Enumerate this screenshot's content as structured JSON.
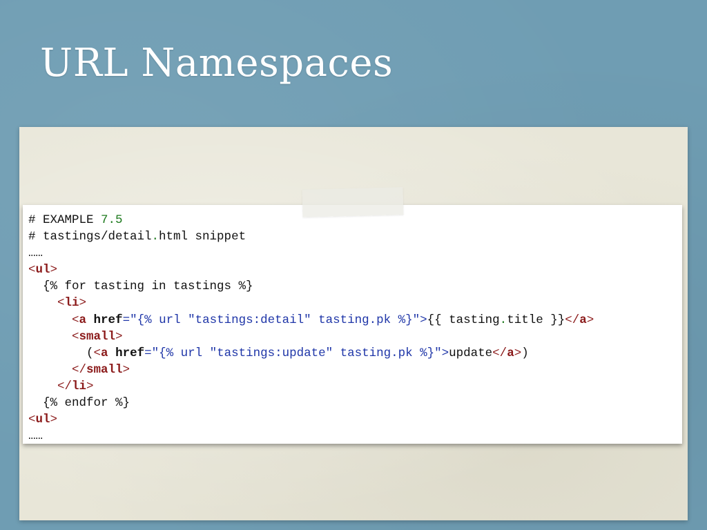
{
  "slide": {
    "title": "URL Namespaces"
  },
  "code": {
    "lines": [
      [
        {
          "t": "# EXAMPLE ",
          "c": ""
        },
        {
          "t": "7.5",
          "c": "num"
        }
      ],
      [
        {
          "t": "# tastings/detail",
          "c": ""
        },
        {
          "t": ".",
          "c": "punct"
        },
        {
          "t": "html snippet",
          "c": ""
        }
      ],
      [
        {
          "t": "……",
          "c": ""
        }
      ],
      [
        {
          "t": "<",
          "c": "tag"
        },
        {
          "t": "ul",
          "c": "tagname"
        },
        {
          "t": ">",
          "c": "tag"
        }
      ],
      [
        {
          "t": "  {% for tasting in tastings %}",
          "c": ""
        }
      ],
      [
        {
          "t": "    <",
          "c": "tag"
        },
        {
          "t": "li",
          "c": "tagname"
        },
        {
          "t": ">",
          "c": "tag"
        }
      ],
      [
        {
          "t": "      <",
          "c": "tag"
        },
        {
          "t": "a",
          "c": "tagname"
        },
        {
          "t": " ",
          "c": ""
        },
        {
          "t": "href",
          "c": "attr"
        },
        {
          "t": "=\"{% url \"tastings:detail\" tasting.pk %}\">",
          "c": "str"
        },
        {
          "t": "{{ tasting",
          "c": ""
        },
        {
          "t": ".",
          "c": "punct"
        },
        {
          "t": "title }}",
          "c": ""
        },
        {
          "t": "</",
          "c": "tag"
        },
        {
          "t": "a",
          "c": "tagname"
        },
        {
          "t": ">",
          "c": "tag"
        }
      ],
      [
        {
          "t": "      <",
          "c": "tag"
        },
        {
          "t": "small",
          "c": "tagname"
        },
        {
          "t": ">",
          "c": "tag"
        }
      ],
      [
        {
          "t": "        (",
          "c": ""
        },
        {
          "t": "<",
          "c": "tag"
        },
        {
          "t": "a",
          "c": "tagname"
        },
        {
          "t": " ",
          "c": ""
        },
        {
          "t": "href",
          "c": "attr"
        },
        {
          "t": "=\"{% url \"tastings:update\" tasting.pk %}\">",
          "c": "str"
        },
        {
          "t": "update",
          "c": ""
        },
        {
          "t": "</",
          "c": "tag"
        },
        {
          "t": "a",
          "c": "tagname"
        },
        {
          "t": ">",
          "c": "tag"
        },
        {
          "t": ")",
          "c": ""
        }
      ],
      [
        {
          "t": "      </",
          "c": "tag"
        },
        {
          "t": "small",
          "c": "tagname"
        },
        {
          "t": ">",
          "c": "tag"
        }
      ],
      [
        {
          "t": "    </",
          "c": "tag"
        },
        {
          "t": "li",
          "c": "tagname"
        },
        {
          "t": ">",
          "c": "tag"
        }
      ],
      [
        {
          "t": "  {% endfor %}",
          "c": ""
        }
      ],
      [
        {
          "t": "<",
          "c": "tag"
        },
        {
          "t": "ul",
          "c": "tagname"
        },
        {
          "t": ">",
          "c": "tag"
        }
      ],
      [
        {
          "t": "……",
          "c": ""
        }
      ]
    ]
  },
  "colors": {
    "background": "#6f9db3",
    "paper": "#e8e6d8",
    "code_card": "#ffffff",
    "number": "#1e7a1e",
    "tag": "#8b1a1a",
    "string": "#1f36a8"
  }
}
